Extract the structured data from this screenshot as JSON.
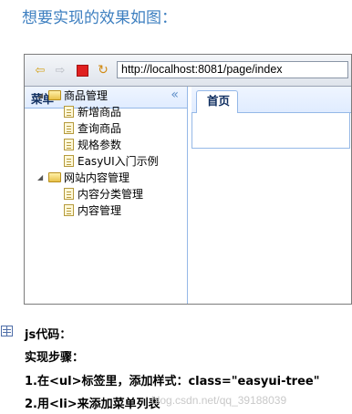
{
  "heading": "想要实现的效果如图：",
  "browser": {
    "url": "http://localhost:8081/page/index"
  },
  "west": {
    "title": "菜单",
    "collapse_symbol": "«"
  },
  "tree": [
    {
      "label": "商品管理",
      "type": "folder",
      "expanded": true,
      "children": [
        {
          "label": "新增商品",
          "type": "file"
        },
        {
          "label": "查询商品",
          "type": "file"
        },
        {
          "label": "规格参数",
          "type": "file"
        },
        {
          "label": "EasyUI入门示例",
          "type": "file"
        }
      ]
    },
    {
      "label": "网站内容管理",
      "type": "folder",
      "expanded": true,
      "children": [
        {
          "label": "内容分类管理",
          "type": "file"
        },
        {
          "label": "内容管理",
          "type": "file"
        }
      ]
    }
  ],
  "tabs": [
    {
      "label": "首页",
      "active": true
    }
  ],
  "article": {
    "line1": "js代码：",
    "line2": "实现步骤：",
    "line3": "1.在<ul>标签里，添加样式：class=\"easyui-tree\"",
    "line4": "2.用<li>来添加菜单列表",
    "watermark": "blog.csdn.net/qq_39188039"
  }
}
